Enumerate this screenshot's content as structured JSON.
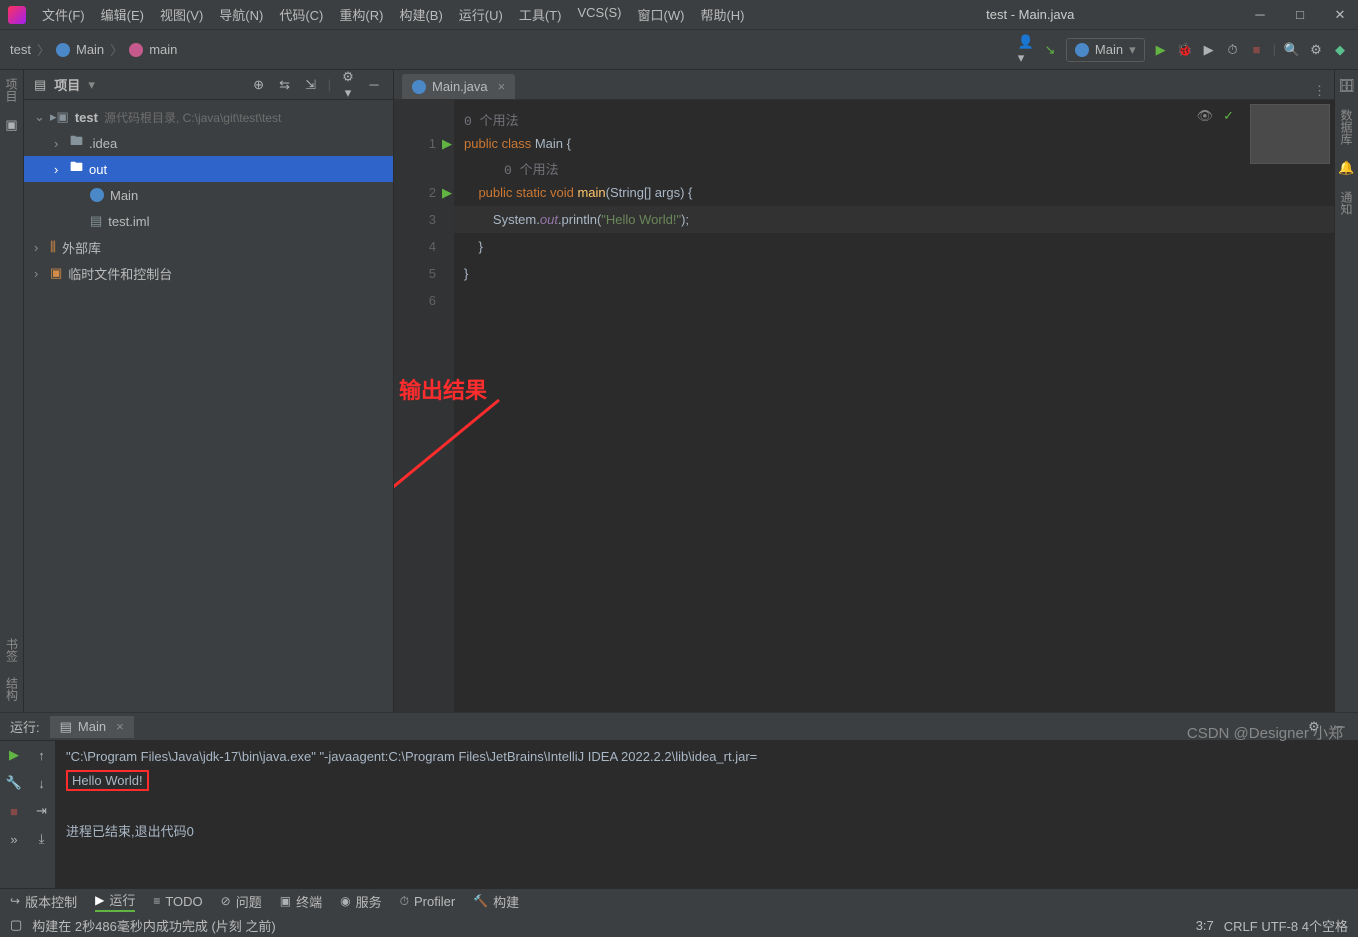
{
  "window": {
    "title": "test - Main.java"
  },
  "menu": {
    "file": "文件(F)",
    "edit": "编辑(E)",
    "view": "视图(V)",
    "nav": "导航(N)",
    "code": "代码(C)",
    "refactor": "重构(R)",
    "build": "构建(B)",
    "run": "运行(U)",
    "tools": "工具(T)",
    "vcs": "VCS(S)",
    "window": "窗口(W)",
    "help": "帮助(H)"
  },
  "breadcrumb": {
    "p0": "test",
    "p1": "Main",
    "p2": "main"
  },
  "runconfig": {
    "name": "Main"
  },
  "leftbar": {
    "project": "项目",
    "bookmarks": "书签",
    "structure": "结构"
  },
  "rightbar": {
    "db": "数据库",
    "notify": "通知"
  },
  "projectPanel": {
    "title": "项目"
  },
  "tree": {
    "root": "test",
    "rootInfo": "源代码根目录, C:\\java\\git\\test\\test",
    "idea": ".idea",
    "out": "out",
    "main": "Main",
    "iml": "test.iml",
    "ext": "外部库",
    "scratch": "临时文件和控制台"
  },
  "tab": {
    "name": "Main.java"
  },
  "hints": {
    "h0": "0 个用法",
    "h1": "0 个用法"
  },
  "code": {
    "l1": {
      "a": "public class ",
      "b": "Main ",
      "c": "{"
    },
    "l2": {
      "a": "    public static void ",
      "b": "main",
      "c": "(",
      "d": "String",
      "e": "[] args) {"
    },
    "l3": {
      "a": "        System.",
      "b": "out",
      "c": ".println(",
      "d": "\"Hello World!\"",
      "e": ");"
    },
    "l4": "    }",
    "l5": "}"
  },
  "annotation": {
    "label": "输出结果"
  },
  "run": {
    "title": "运行:",
    "tab": "Main"
  },
  "console": {
    "cmd": "\"C:\\Program Files\\Java\\jdk-17\\bin\\java.exe\" \"-javaagent:C:\\Program Files\\JetBrains\\IntelliJ IDEA 2022.2.2\\lib\\idea_rt.jar=",
    "out": "Hello World!",
    "exit": "进程已结束,退出代码0"
  },
  "bottom": {
    "vcs": "版本控制",
    "run": "运行",
    "todo": "TODO",
    "problems": "问题",
    "terminal": "终端",
    "services": "服务",
    "profiler": "Profiler",
    "build": "构建"
  },
  "status": {
    "msg": "构建在 2秒486毫秒内成功完成 (片刻 之前)",
    "pos": "3:7",
    "enc": "CRLF   UTF-8   4个空格"
  },
  "watermark": "CSDN @Designer 小郑"
}
